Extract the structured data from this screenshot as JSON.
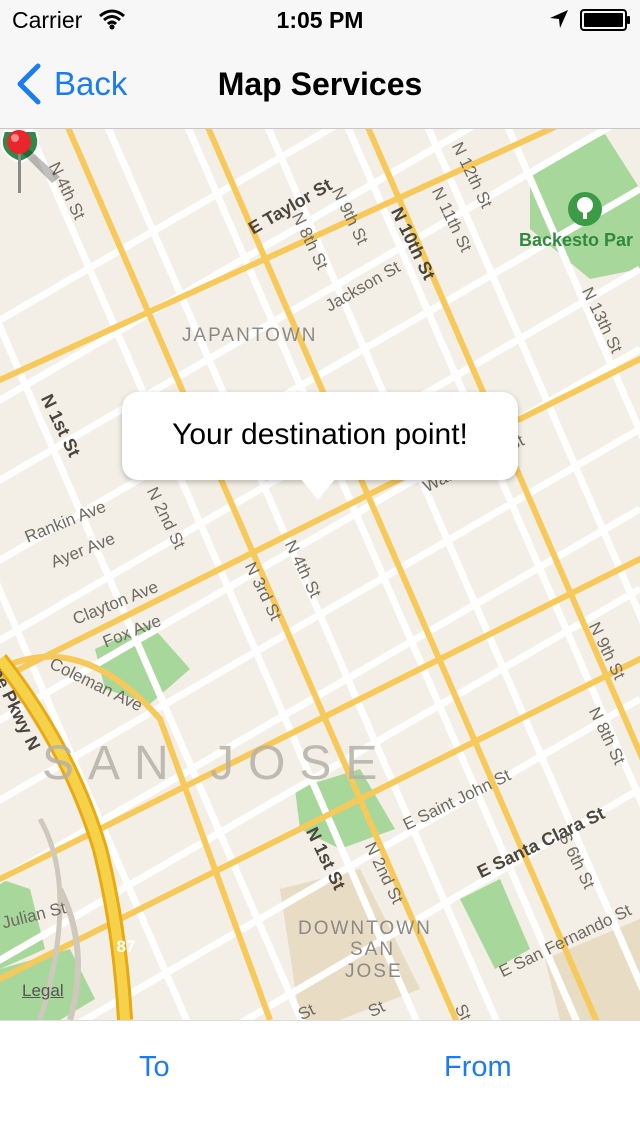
{
  "status_bar": {
    "carrier": "Carrier",
    "time": "1:05 PM"
  },
  "nav": {
    "back_label": "Back",
    "title": "Map Services"
  },
  "map": {
    "streets": [
      "N 4th St",
      "E Taylor St",
      "N 9th St",
      "N 8th St",
      "N 10th St",
      "N 11th St",
      "N 12th St",
      "Jackson St",
      "N 13th St",
      "N 1st St",
      "N 2nd St",
      "Rankin Ave",
      "Ayer Ave",
      "Clayton Ave",
      "Fox Ave",
      "Coleman Ave",
      "N 3rd St",
      "N 4th St",
      "N 9th St",
      "N 8th St",
      "E Saint John St",
      "E Santa Clara St",
      "S 6th St",
      "N 1st St",
      "N 2nd St",
      "Julian St",
      "E San Fernando St",
      "Washington St",
      "St",
      "St",
      "St",
      "ope Pkwy N"
    ],
    "districts": [
      "JAPANTOWN",
      "DOWNTOWN",
      "SAN",
      "JOSE"
    ],
    "city": "SAN JOSE",
    "park": "Backesto Par",
    "highway": "87",
    "legal": "Legal",
    "callout": "Your destination point!"
  },
  "toolbar": {
    "to_label": "To",
    "from_label": "From"
  },
  "colors": {
    "accent": "#1b7cf2",
    "map_bg": "#f3efe6",
    "road_major": "#f7c95a",
    "park": "#a7d79a",
    "pin": "#e8262b"
  }
}
